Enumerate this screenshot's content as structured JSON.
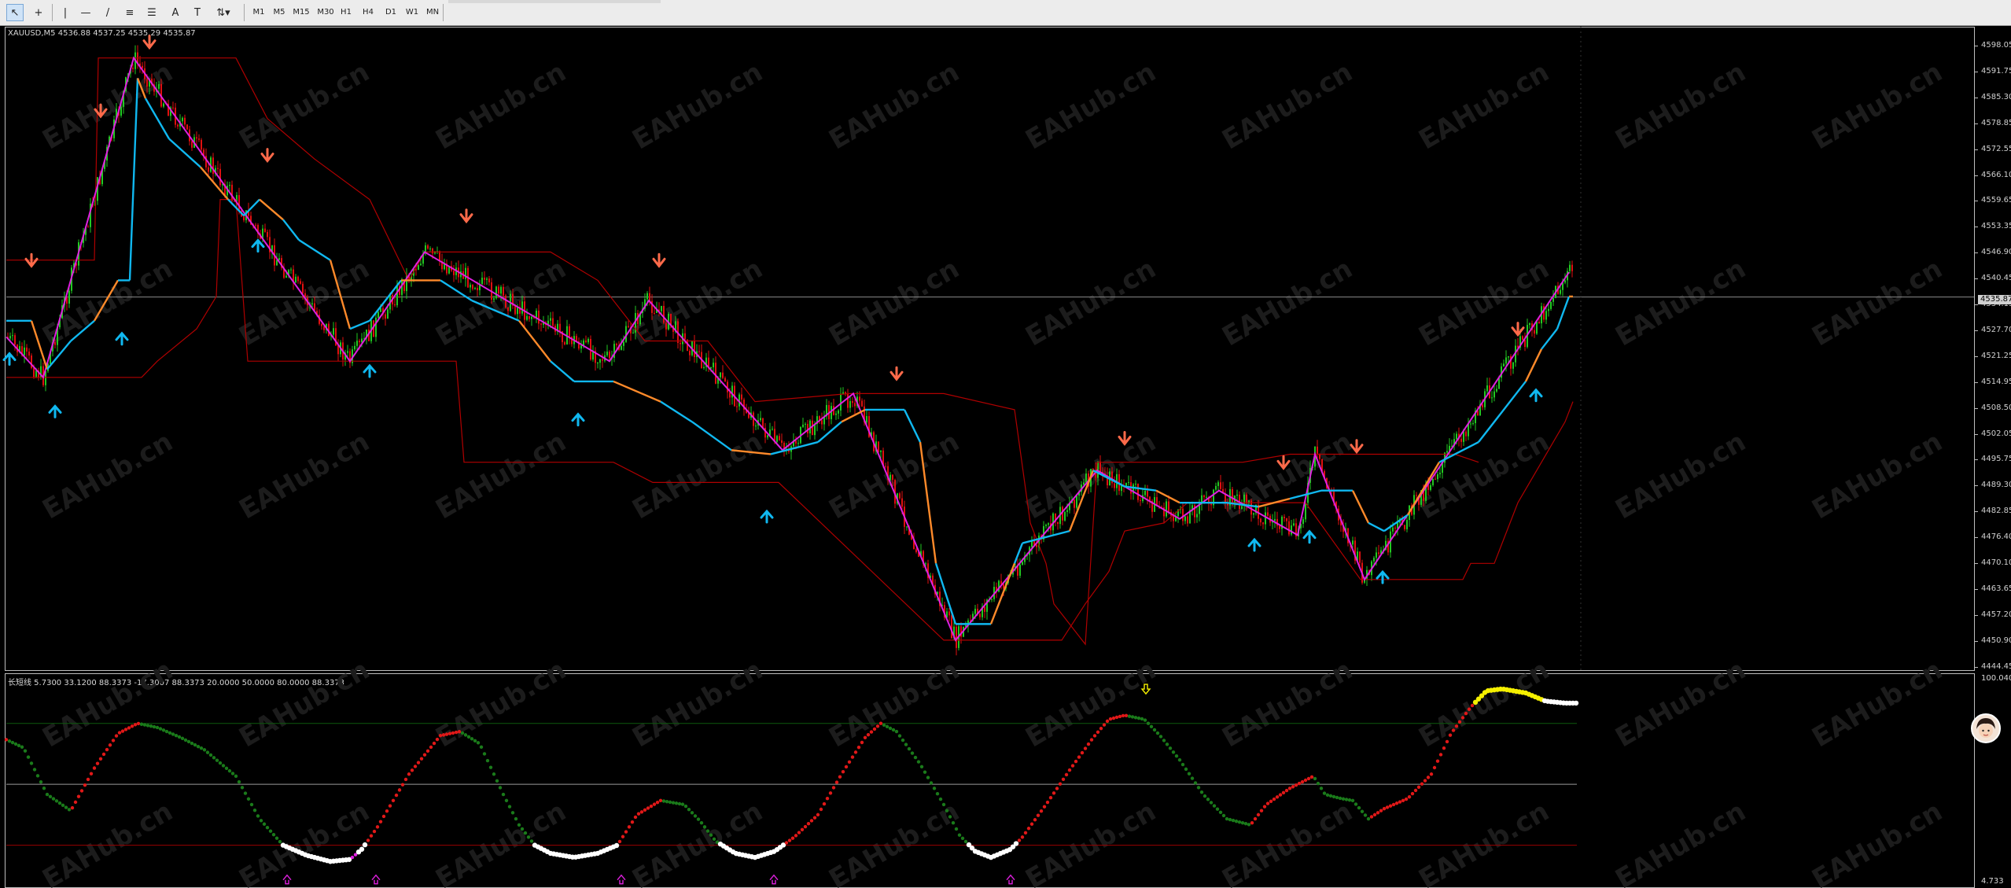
{
  "toolbar": {
    "tools": [
      {
        "name": "cursor-icon",
        "glyph": "↖"
      },
      {
        "name": "crosshair-icon",
        "glyph": "+"
      },
      {
        "name": "vertical-line-icon",
        "glyph": "|"
      },
      {
        "name": "horizontal-line-icon",
        "glyph": "—"
      },
      {
        "name": "trendline-icon",
        "glyph": "/"
      },
      {
        "name": "channel-icon",
        "glyph": "≡"
      },
      {
        "name": "fibonacci-icon",
        "glyph": "☰"
      },
      {
        "name": "text-icon",
        "glyph": "A"
      },
      {
        "name": "text-label-icon",
        "glyph": "T"
      },
      {
        "name": "arrows-icon",
        "glyph": "⇅"
      }
    ],
    "timeframes": [
      "M1",
      "M5",
      "M15",
      "M30",
      "H1",
      "H4",
      "D1",
      "W1",
      "MN"
    ]
  },
  "main_chart": {
    "header": "XAUUSD,M5  4536.88 4537.25 4535.29 4535.87",
    "current_price": "4535.87",
    "price_labels": [
      "4598.05",
      "4591.75",
      "4585.30",
      "4578.85",
      "4572.55",
      "4566.10",
      "4559.65",
      "4553.35",
      "4546.90",
      "4540.45",
      "4534.15",
      "4527.70",
      "4521.25",
      "4514.95",
      "4508.50",
      "4502.05",
      "4495.75",
      "4489.30",
      "4482.85",
      "4476.40",
      "4470.10",
      "4463.65",
      "4457.20",
      "4450.90",
      "4444.45"
    ]
  },
  "sub_chart": {
    "header": "长短线  5.7300 33.1200 88.3373 -17.3007 88.3373 20.0000 50.0000 80.0000 88.3373",
    "top_label": "100.0407",
    "bottom_label": "4.733"
  },
  "watermark": "EAHub.cn",
  "colors": {
    "background": "#000000",
    "bull_candle": "#22c922",
    "bear_candle": "#e01010",
    "zigzag": "#e020e0",
    "signal_up": "#10b8f0",
    "signal_down": "#ff6a4a",
    "channel": "#b00000",
    "osc_green": "#1a7a1a",
    "osc_red": "#e01818",
    "osc_white": "#ffffff",
    "osc_yellow": "#f5f000"
  }
}
